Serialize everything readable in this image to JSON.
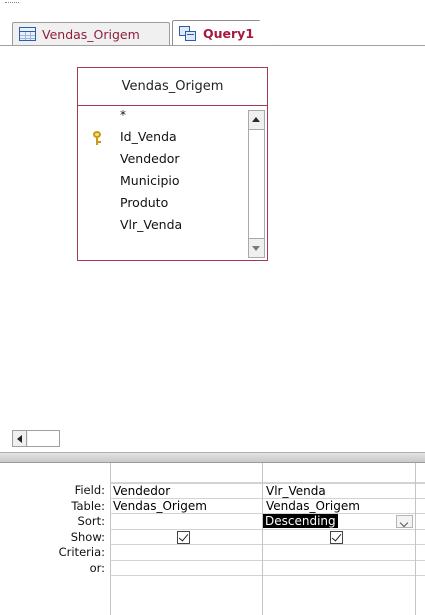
{
  "tabs": [
    {
      "label": "Vendas_Origem",
      "icon": "table-icon",
      "active": false
    },
    {
      "label": "Query1",
      "icon": "query-icon",
      "active": true
    }
  ],
  "field_list": {
    "title": "Vendas_Origem",
    "items": [
      {
        "label": "*",
        "primary_key": false
      },
      {
        "label": "Id_Venda",
        "primary_key": true
      },
      {
        "label": "Vendedor",
        "primary_key": false
      },
      {
        "label": "Municipio",
        "primary_key": false
      },
      {
        "label": "Produto",
        "primary_key": false
      },
      {
        "label": "Vlr_Venda",
        "primary_key": false
      }
    ]
  },
  "grid": {
    "row_labels": [
      "Field:",
      "Table:",
      "Sort:",
      "Show:",
      "Criteria:",
      "or:"
    ],
    "columns": [
      {
        "field": "Vendedor",
        "table": "Vendas_Origem",
        "sort": "",
        "show": true
      },
      {
        "field": "Vlr_Venda",
        "table": "Vendas_Origem",
        "sort": "Descending",
        "show": true
      }
    ]
  },
  "colors": {
    "tab_inactive_text": "#8e1f3e",
    "tab_active_text": "#a7193d",
    "field_list_border": "#a33a4f",
    "selection_bg": "#000000"
  }
}
